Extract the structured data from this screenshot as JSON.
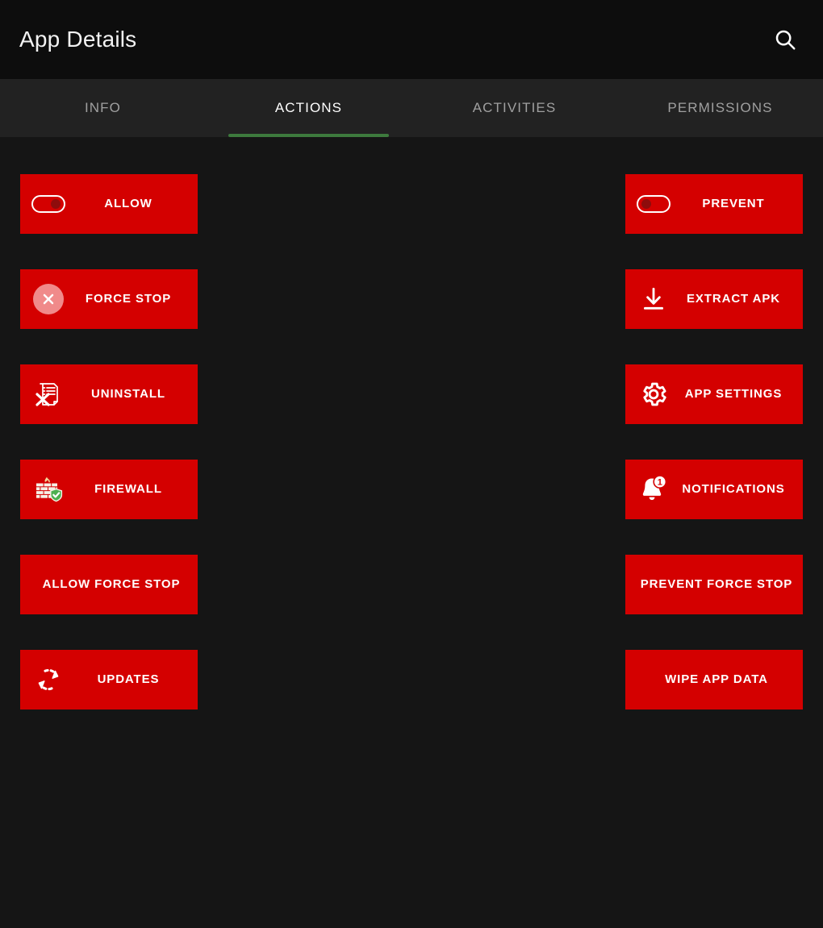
{
  "appbar": {
    "title": "App Details",
    "search_icon": "search-icon"
  },
  "tabs": [
    {
      "label": "INFO",
      "active": false
    },
    {
      "label": "ACTIONS",
      "active": true
    },
    {
      "label": "ACTIVITIES",
      "active": false
    },
    {
      "label": "PERMISSIONS",
      "active": false
    }
  ],
  "actions": {
    "left": [
      {
        "label": "ALLOW",
        "icon": "toggle-on-icon"
      },
      {
        "label": "FORCE STOP",
        "icon": "circle-x-icon"
      },
      {
        "label": "UNINSTALL",
        "icon": "document-delete-icon"
      },
      {
        "label": "FIREWALL",
        "icon": "firewall-shield-icon"
      },
      {
        "label": "ALLOW FORCE STOP",
        "icon": "none"
      },
      {
        "label": "UPDATES",
        "icon": "refresh-sync-icon"
      }
    ],
    "right": [
      {
        "label": "PREVENT",
        "icon": "toggle-off-icon"
      },
      {
        "label": "EXTRACT APK",
        "icon": "download-icon"
      },
      {
        "label": "APP SETTINGS",
        "icon": "gear-icon"
      },
      {
        "label": "NOTIFICATIONS",
        "icon": "bell-badge-icon"
      },
      {
        "label": "PREVENT FORCE STOP",
        "icon": "none"
      },
      {
        "label": "WIPE APP DATA",
        "icon": "none"
      }
    ]
  },
  "badges": {
    "notification_count": "1"
  },
  "colors": {
    "background": "#151515",
    "appbar": "#0d0d0d",
    "tabbar": "#222222",
    "button": "#d40000",
    "accent": "#3d7a3d",
    "text": "#ffffff",
    "tab_inactive": "#a0a0a0"
  }
}
